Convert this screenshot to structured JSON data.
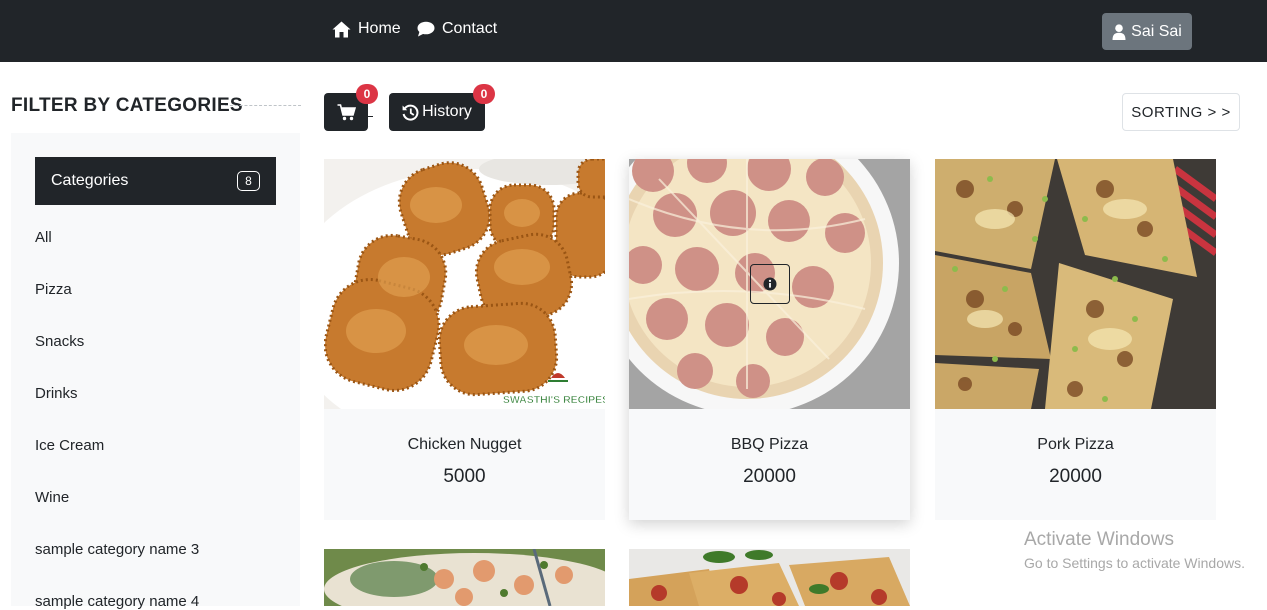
{
  "nav": {
    "home": "Home",
    "contact": "Contact",
    "user": "Sai Sai"
  },
  "sidebar": {
    "title": "FILTER BY CATEGORIES",
    "header_label": "Categories",
    "header_count": "8",
    "items": [
      {
        "label": "All"
      },
      {
        "label": "Pizza"
      },
      {
        "label": "Snacks"
      },
      {
        "label": "Drinks"
      },
      {
        "label": "Ice Cream"
      },
      {
        "label": "Wine"
      },
      {
        "label": "sample category name 3"
      },
      {
        "label": "sample category name 4"
      }
    ]
  },
  "toolbar": {
    "cart_count": "0",
    "history_label": "History",
    "history_count": "0",
    "sorting_label": "SORTING > >"
  },
  "products": [
    {
      "name": "Chicken Nugget",
      "price": "5000",
      "image_text": "SWASTHI'S RECIPES"
    },
    {
      "name": "BBQ Pizza",
      "price": "20000"
    },
    {
      "name": "Pork Pizza",
      "price": "20000"
    }
  ],
  "watermark": {
    "line1": "Activate Windows",
    "line2": "Go to Settings to activate Windows."
  },
  "colors": {
    "navbar": "#212529",
    "user_button": "#6c757d",
    "badge": "#dc3545",
    "sidebar_bg": "#f8f9fa"
  },
  "icons": [
    "home-icon",
    "chat-bubble-icon",
    "user-icon",
    "cart-icon",
    "history-icon",
    "info-icon"
  ]
}
